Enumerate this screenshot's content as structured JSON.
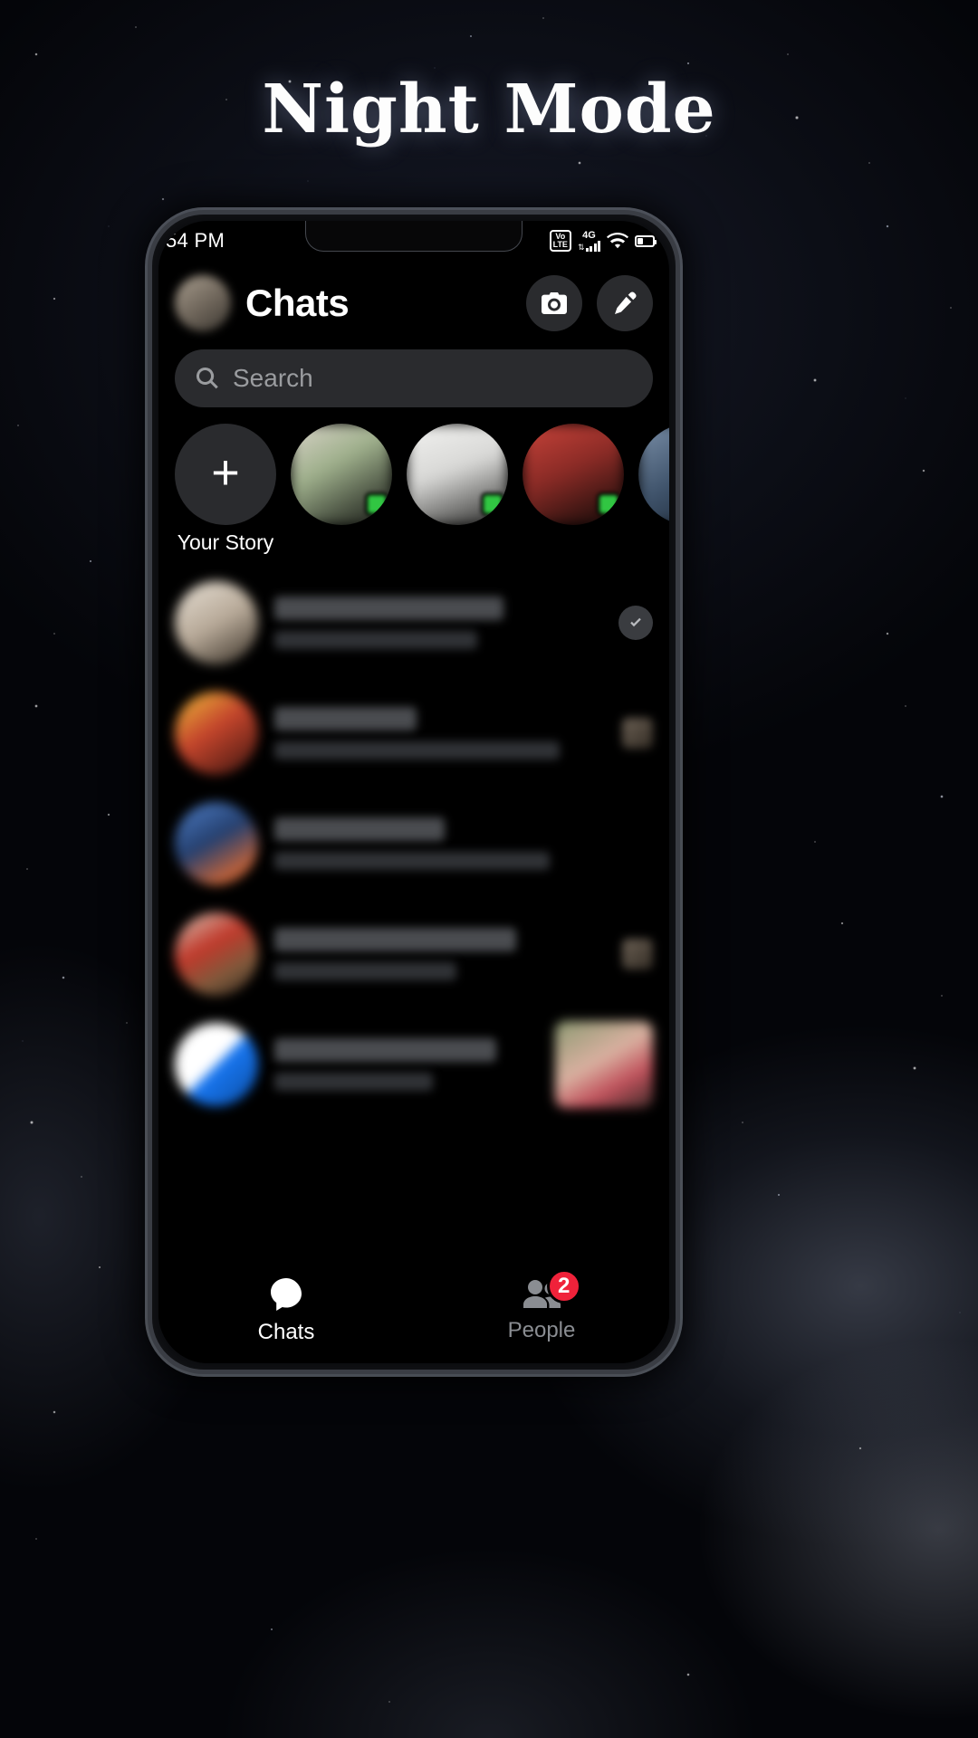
{
  "poster": {
    "title": "Night Mode",
    "background_color": "#04050a"
  },
  "phone": {
    "status_bar": {
      "time": "54 PM",
      "icons": [
        {
          "name": "volte-icon",
          "label_top": "Vo",
          "label_bottom": "LTE"
        },
        {
          "name": "network-type-label",
          "label": "4G"
        },
        {
          "name": "cellular-signal-icon",
          "label": ""
        },
        {
          "name": "wifi-icon",
          "label": ""
        },
        {
          "name": "battery-icon",
          "label": ""
        }
      ]
    },
    "header": {
      "title": "Chats",
      "avatar_name": "profile-avatar",
      "camera_button": "camera-icon",
      "compose_button": "compose-icon"
    },
    "search": {
      "placeholder": "Search"
    },
    "stories": {
      "add_story_label": "Your Story",
      "items": [
        {
          "label": "Your Story",
          "type": "add",
          "online": false
        },
        {
          "label": "",
          "type": "story",
          "online": true
        },
        {
          "label": "",
          "type": "story",
          "online": true
        },
        {
          "label": "",
          "type": "story",
          "online": true
        },
        {
          "label": "",
          "type": "story",
          "online": false
        }
      ]
    },
    "chats": [
      {
        "name": "",
        "preview": "",
        "right": "read-receipt"
      },
      {
        "name": "",
        "preview": "",
        "right": "thumbnail-small"
      },
      {
        "name": "",
        "preview": "",
        "right": "none"
      },
      {
        "name": "",
        "preview": "",
        "right": "thumbnail-small"
      },
      {
        "name": "",
        "preview": "",
        "right": "thumbnail-large"
      }
    ],
    "bottom_nav": [
      {
        "label": "Chats",
        "icon": "chat-bubble-icon",
        "active": true,
        "badge": ""
      },
      {
        "label": "People",
        "icon": "people-icon",
        "active": false,
        "badge": "2"
      }
    ]
  },
  "colors": {
    "accent_badge": "#f0223a",
    "online_green": "#31c642",
    "surface": "#2a2b2e",
    "screen_bg": "#000000"
  }
}
